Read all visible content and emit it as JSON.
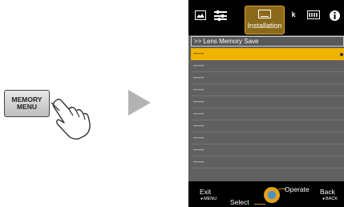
{
  "remote": {
    "button_line1": "MEMORY",
    "button_line2": "MENU"
  },
  "osd": {
    "tabs": [
      {
        "icon": "picture-icon"
      },
      {
        "icon": "adjust-sliders-icon"
      },
      {
        "icon": "installation-icon",
        "label": "Installation",
        "active": true
      },
      {
        "icon": "wrench-icon"
      },
      {
        "icon": "display-icon"
      },
      {
        "icon": "info-icon"
      }
    ],
    "title": ">> Lens Memory Save",
    "rows": [
      "-----",
      "-----",
      "-----",
      "-----",
      "-----",
      "-----",
      "-----",
      "-----",
      "-----",
      "-----"
    ],
    "selected_row_index": 0,
    "footer": {
      "exit_label": "Exit",
      "exit_key": "MENU",
      "select_label": "Select",
      "operate_label": "Operate",
      "back_label": "Back",
      "back_key": "BACK"
    }
  },
  "colors": {
    "highlight": "#f0b400",
    "active_tab": "#8a6a1a",
    "panel": "#606060"
  }
}
